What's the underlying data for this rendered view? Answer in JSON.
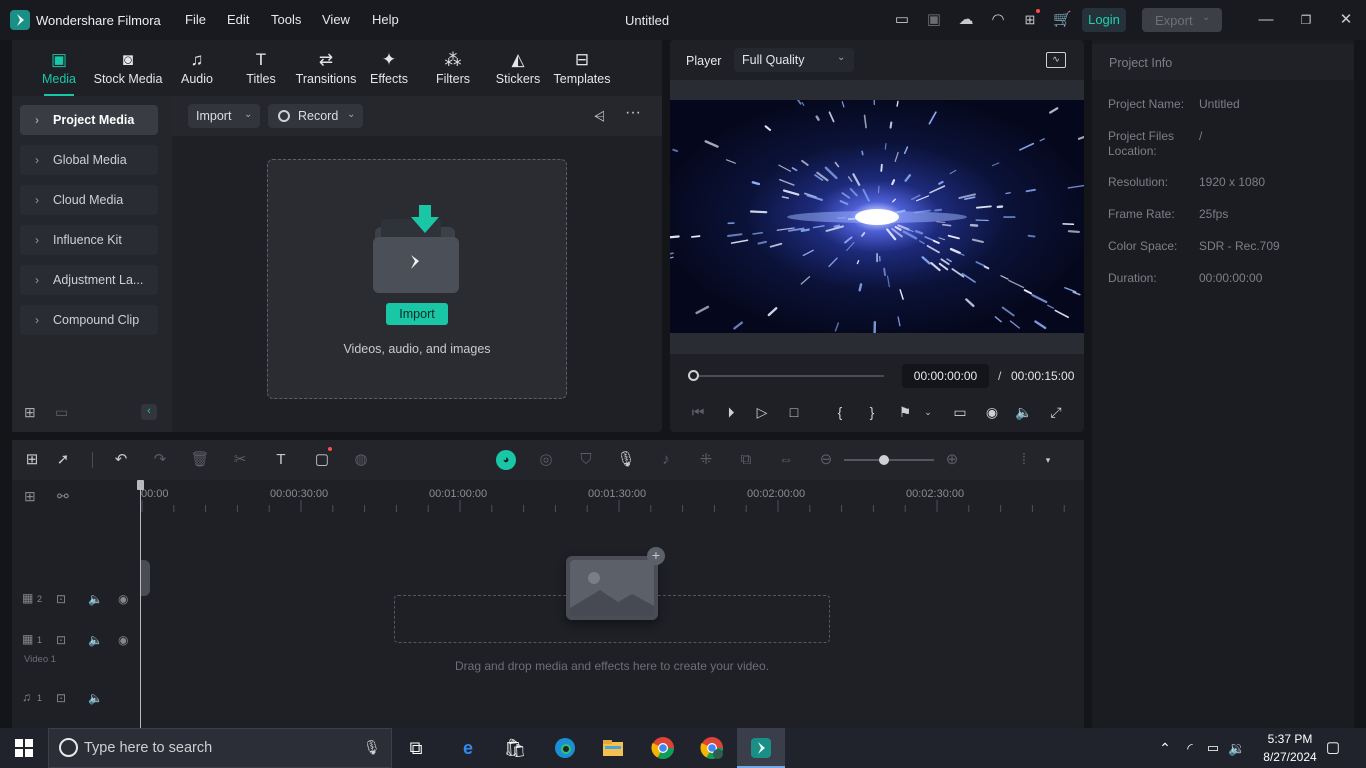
{
  "app": {
    "name": "Wondershare Filmora",
    "title": "Untitled",
    "menu": [
      "File",
      "Edit",
      "Tools",
      "View",
      "Help"
    ],
    "login_label": "Login",
    "export_label": "Export"
  },
  "tabs": [
    {
      "label": "Media",
      "icon": "media-icon"
    },
    {
      "label": "Stock Media",
      "icon": "stock-media-icon"
    },
    {
      "label": "Audio",
      "icon": "music-note-icon"
    },
    {
      "label": "Titles",
      "icon": "titles-t-icon"
    },
    {
      "label": "Transitions",
      "icon": "transitions-icon"
    },
    {
      "label": "Effects",
      "icon": "effects-sparkle-icon"
    },
    {
      "label": "Filters",
      "icon": "filters-icon"
    },
    {
      "label": "Stickers",
      "icon": "stickers-icon"
    },
    {
      "label": "Templates",
      "icon": "templates-icon"
    }
  ],
  "sidebar": {
    "items": [
      {
        "label": "Project Media"
      },
      {
        "label": "Global Media"
      },
      {
        "label": "Cloud Media"
      },
      {
        "label": "Influence Kit"
      },
      {
        "label": "Adjustment La..."
      },
      {
        "label": "Compound Clip"
      }
    ]
  },
  "media": {
    "import_dropdown": "Import",
    "record_dropdown": "Record",
    "import_button": "Import",
    "drop_hint": "Videos, audio, and images"
  },
  "player": {
    "label": "Player",
    "quality": "Full Quality",
    "current_time": "00:00:00:00",
    "separator": "/",
    "total_time": "00:00:15:00"
  },
  "project_info": {
    "title": "Project Info",
    "rows": [
      {
        "label": "Project Name:",
        "value": "Untitled"
      },
      {
        "label": "Project Files Location:",
        "value": "/"
      },
      {
        "label": "Resolution:",
        "value": "1920 x 1080"
      },
      {
        "label": "Frame Rate:",
        "value": "25fps"
      },
      {
        "label": "Color Space:",
        "value": "SDR - Rec.709"
      },
      {
        "label": "Duration:",
        "value": "00:00:00:00"
      }
    ]
  },
  "timeline": {
    "ruler": [
      "00:00",
      "00:00:30:00",
      "00:01:00:00",
      "00:01:30:00",
      "00:02:00:00",
      "00:02:30:00"
    ],
    "video_track_label": "Video 1",
    "track2_num": "2",
    "track1_num": "1",
    "audio_num": "1",
    "drop_hint": "Drag and drop media and effects here to create your video."
  },
  "taskbar": {
    "search_placeholder": "Type here to search",
    "time": "5:37 PM",
    "date": "8/27/2024"
  },
  "colors": {
    "accent": "#19c7a6",
    "login_bg": "#25323a",
    "login_text": "#1fd1b0"
  }
}
